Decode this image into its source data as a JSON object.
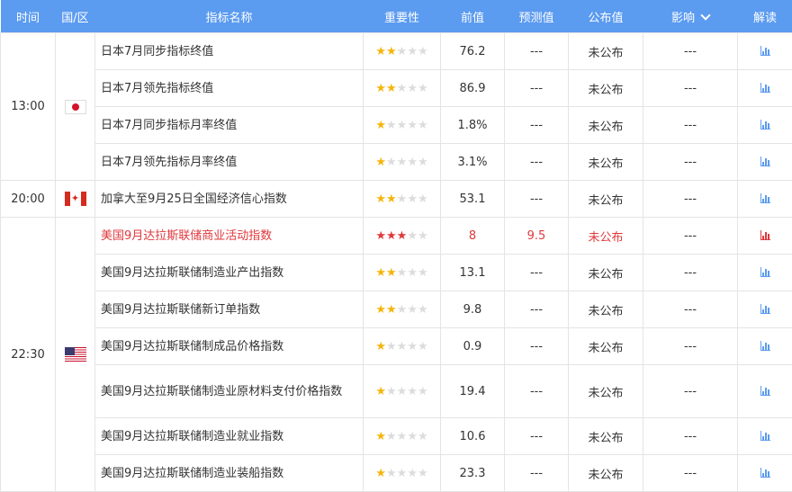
{
  "headers": {
    "time": "时间",
    "country": "国/区",
    "name": "指标名称",
    "importance": "重要性",
    "previous": "前值",
    "forecast": "预测值",
    "actual": "公布值",
    "impact": "影响",
    "analysis": "解读"
  },
  "groups": [
    {
      "time": "13:00",
      "flag": "japan-flag-icon",
      "rows": [
        {
          "name": "日本7月同步指标终值",
          "stars": 2,
          "previous": "76.2",
          "forecast": "---",
          "actual": "未公布",
          "impact": "---"
        },
        {
          "name": "日本7月领先指标终值",
          "stars": 2,
          "previous": "86.9",
          "forecast": "---",
          "actual": "未公布",
          "impact": "---"
        },
        {
          "name": "日本7月同步指标月率终值",
          "stars": 1,
          "previous": "1.8%",
          "forecast": "---",
          "actual": "未公布",
          "impact": "---"
        },
        {
          "name": "日本7月领先指标月率终值",
          "stars": 1,
          "previous": "3.1%",
          "forecast": "---",
          "actual": "未公布",
          "impact": "---"
        }
      ]
    },
    {
      "time": "20:00",
      "flag": "canada-flag-icon",
      "rows": [
        {
          "name": "加拿大至9月25日全国经济信心指数",
          "stars": 2,
          "previous": "53.1",
          "forecast": "---",
          "actual": "未公布",
          "impact": "---"
        }
      ]
    },
    {
      "time": "22:30",
      "flag": "usa-flag-icon",
      "rows": [
        {
          "name": "美国9月达拉斯联储商业活动指数",
          "stars": 3,
          "previous": "8",
          "forecast": "9.5",
          "actual": "未公布",
          "impact": "---",
          "important": true
        },
        {
          "name": "美国9月达拉斯联储制造业产出指数",
          "stars": 2,
          "previous": "13.1",
          "forecast": "---",
          "actual": "未公布",
          "impact": "---"
        },
        {
          "name": "美国9月达拉斯联储新订单指数",
          "stars": 2,
          "previous": "9.8",
          "forecast": "---",
          "actual": "未公布",
          "impact": "---"
        },
        {
          "name": "美国9月达拉斯联储制成品价格指数",
          "stars": 1,
          "previous": "0.9",
          "forecast": "---",
          "actual": "未公布",
          "impact": "---"
        },
        {
          "name": "美国9月达拉斯联储制造业原材料支付价格指数",
          "stars": 1,
          "previous": "19.4",
          "forecast": "---",
          "actual": "未公布",
          "impact": "---",
          "tall": true
        },
        {
          "name": "美国9月达拉斯联储制造业就业指数",
          "stars": 1,
          "previous": "10.6",
          "forecast": "---",
          "actual": "未公布",
          "impact": "---"
        },
        {
          "name": "美国9月达拉斯联储制造业装船指数",
          "stars": 1,
          "previous": "23.3",
          "forecast": "---",
          "actual": "未公布",
          "impact": "---"
        }
      ]
    }
  ],
  "max_stars": 5,
  "colors": {
    "header_bg": "#5b9bf0",
    "star_on": "#f5b50a",
    "star_off": "#dcdcdc",
    "important": "#e0383c",
    "chart_icon": "#5b9bf0"
  }
}
